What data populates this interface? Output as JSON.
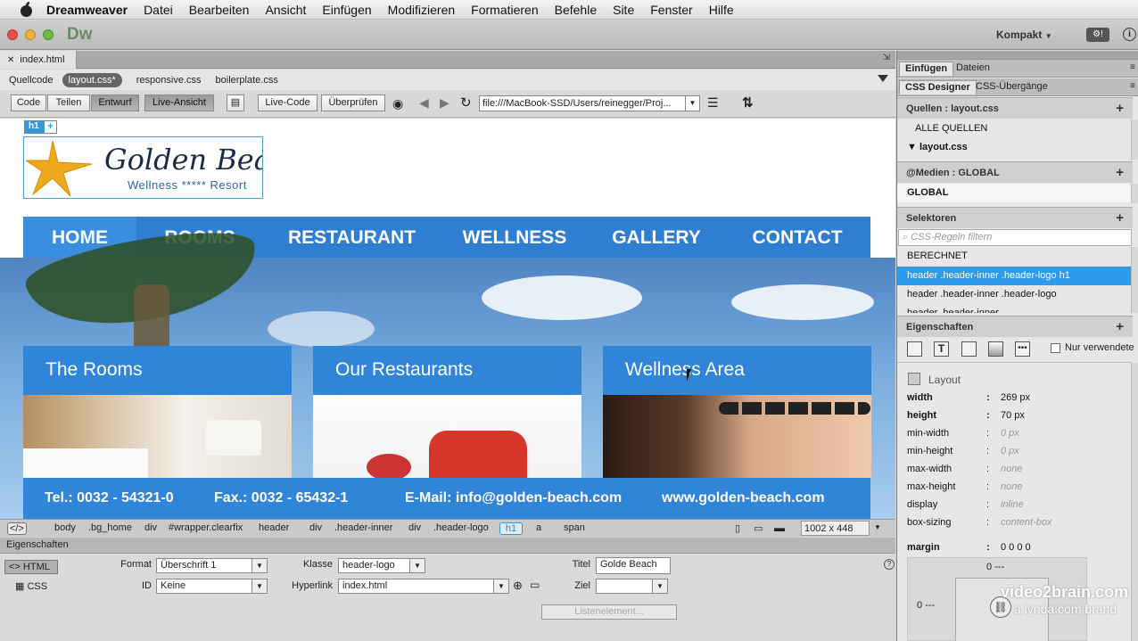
{
  "menubar": {
    "app": "Dreamweaver",
    "items": [
      "Datei",
      "Bearbeiten",
      "Ansicht",
      "Einfügen",
      "Modifizieren",
      "Formatieren",
      "Befehle",
      "Site",
      "Fenster",
      "Hilfe"
    ]
  },
  "titlebar": {
    "logo": "Dw",
    "workspace": "Kompakt"
  },
  "document": {
    "tab": "index.html",
    "related": [
      "Quellcode",
      "layout.css*",
      "responsive.css",
      "boilerplate.css"
    ]
  },
  "toolbar": {
    "code": "Code",
    "split": "Teilen",
    "design": "Entwurf",
    "live": "Live-Ansicht",
    "livecode": "Live-Code",
    "inspect": "Überprüfen",
    "url": "file:///MacBook-SSD/Users/reinegger/Proj..."
  },
  "page": {
    "h1tag": "h1",
    "logo_title": "Golden Beach",
    "logo_sub": "Wellness ***** Resort",
    "nav": [
      "HOME",
      "ROOMS",
      "RESTAURANT",
      "WELLNESS",
      "GALLERY",
      "CONTACT"
    ],
    "cards": [
      "The Rooms",
      "Our Restaurants",
      "Wellness Area"
    ],
    "info": [
      "Tel.: 0032 - 54321-0",
      "Fax.: 0032 - 65432-1",
      "E-Mail: info@golden-beach.com",
      "www.golden-beach.com"
    ]
  },
  "tagselector": {
    "tags": [
      "body",
      ".bg_home",
      "div",
      "#wrapper.clearfix",
      "header",
      "div",
      ".header-inner",
      "div",
      ".header-logo",
      "h1",
      "a",
      "span"
    ],
    "size": "1002 x 448"
  },
  "properties": {
    "title": "Eigenschaften",
    "html_label": "HTML",
    "css_label": "CSS",
    "format_label": "Format",
    "format_value": "Überschrift 1",
    "id_label": "ID",
    "id_value": "Keine",
    "class_label": "Klasse",
    "class_value": "header-logo",
    "link_label": "Hyperlink",
    "link_value": "index.html",
    "title_label": "Titel",
    "title_value": "Golde Beach",
    "target_label": "Ziel",
    "list_button": "Listenelement..."
  },
  "panels": {
    "tabs1": [
      "Einfügen",
      "Dateien"
    ],
    "tabs2": [
      "CSS Designer",
      "CSS-Übergänge"
    ],
    "sources_head": "Quellen :  layout.css",
    "sources": [
      "ALLE QUELLEN",
      "layout.css"
    ],
    "media_head": "@Medien :  GLOBAL",
    "media": [
      "GLOBAL"
    ],
    "selectors_head": "Selektoren",
    "selectors_filter": "CSS-Regeln filtern",
    "selectors": [
      "BERECHNET",
      "header .header-inner .header-logo h1",
      "header .header-inner .header-logo",
      "header .header-inner"
    ],
    "props_head": "Eigenschaften",
    "only_used": "Nur verwendete",
    "layout_label": "Layout",
    "props": [
      {
        "name": "width",
        "value": "269 px",
        "set": true
      },
      {
        "name": "height",
        "value": "70 px",
        "set": true
      },
      {
        "name": "min-width",
        "value": "0 px",
        "set": false
      },
      {
        "name": "min-height",
        "value": "0 px",
        "set": false
      },
      {
        "name": "max-width",
        "value": "none",
        "set": false
      },
      {
        "name": "max-height",
        "value": "none",
        "set": false
      },
      {
        "name": "display",
        "value": "inline",
        "set": false
      },
      {
        "name": "box-sizing",
        "value": "content-box",
        "set": false
      },
      {
        "name": "margin",
        "value": "0 0 0 0",
        "set": true
      }
    ],
    "margin_top": "0 ---",
    "margin_left": "0 ---"
  },
  "watermark": {
    "brand": "video2brain.com",
    "sub": "a lynda.com brand"
  },
  "colors": {
    "accent": "#3085d8",
    "selection": "#2e9ae8"
  }
}
